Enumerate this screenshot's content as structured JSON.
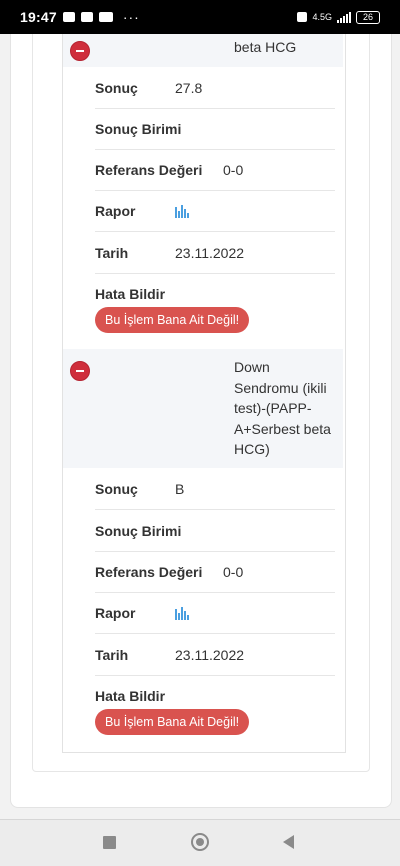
{
  "status_bar": {
    "time": "19:47",
    "network": "4.5G",
    "battery": "26"
  },
  "groups": [
    {
      "title": "beta HCG",
      "rows": {
        "sonuc_label": "Sonuç",
        "sonuc_value": "27.8",
        "birim_label": "Sonuç Birimi",
        "birim_value": "",
        "referans_label": "Referans Değeri",
        "referans_value": "0-0",
        "rapor_label": "Rapor",
        "rapor_icon": "bar-chart-icon",
        "tarih_label": "Tarih",
        "tarih_value": "23.11.2022",
        "hata_label": "Hata Bildir"
      },
      "report_button": "Bu İşlem Bana Ait Değil!"
    },
    {
      "title": "Down Sendromu (ikili test)-(PAPP-A+Serbest beta HCG)",
      "rows": {
        "sonuc_label": "Sonuç",
        "sonuc_value": "B",
        "birim_label": "Sonuç Birimi",
        "birim_value": "",
        "referans_label": "Referans Değeri",
        "referans_value": "0-0",
        "rapor_label": "Rapor",
        "rapor_icon": "bar-chart-icon",
        "tarih_label": "Tarih",
        "tarih_value": "23.11.2022",
        "hata_label": "Hata Bildir"
      },
      "report_button": "Bu İşlem Bana Ait Değil!"
    }
  ],
  "colors": {
    "minus_button": "#cf2e3c",
    "report_button": "#d9534f",
    "chart_icon": "#4a9fe0",
    "header_bg": "#f4f6f9"
  }
}
